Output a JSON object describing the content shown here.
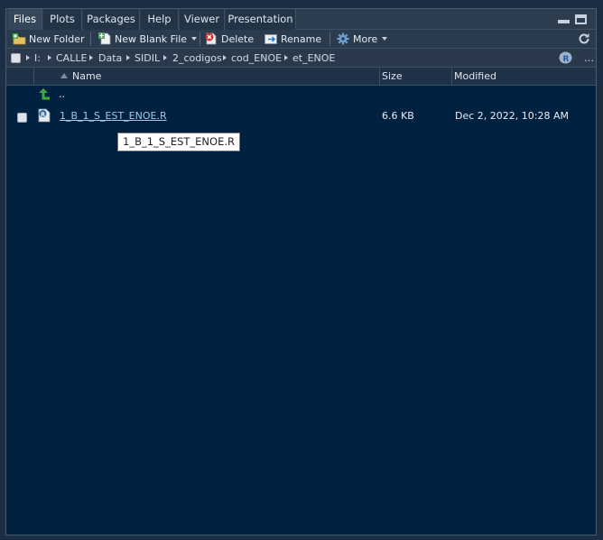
{
  "tabs": [
    {
      "label": "Files",
      "active": true
    },
    {
      "label": "Plots",
      "active": false
    },
    {
      "label": "Packages",
      "active": false
    },
    {
      "label": "Help",
      "active": false
    },
    {
      "label": "Viewer",
      "active": false
    },
    {
      "label": "Presentation",
      "active": false
    }
  ],
  "toolbar": {
    "new_folder": "New Folder",
    "new_blank_file": "New Blank File",
    "delete": "Delete",
    "rename": "Rename",
    "more": "More"
  },
  "breadcrumb": [
    "I:",
    "CALLE",
    "Data",
    "SIDIL",
    "2_codigos",
    "cod_ENOE",
    "et_ENOE"
  ],
  "columns": {
    "name": "Name",
    "size": "Size",
    "modified": "Modified"
  },
  "parent_dir": "..",
  "files": [
    {
      "name": "1_B_1_S_EST_ENOE.R",
      "size": "6.6 KB",
      "modified": "Dec 2, 2022, 10:28 AM"
    }
  ],
  "tooltip": "1_B_1_S_EST_ENOE.R",
  "colors": {
    "background": "#012140",
    "chrome": "#2b3b4e",
    "link": "#a8c4e6"
  },
  "icons": [
    "new-folder-icon",
    "new-file-icon",
    "delete-icon",
    "rename-icon",
    "gear-icon",
    "refresh-icon",
    "r-project-icon",
    "up-arrow-icon",
    "r-file-icon"
  ]
}
